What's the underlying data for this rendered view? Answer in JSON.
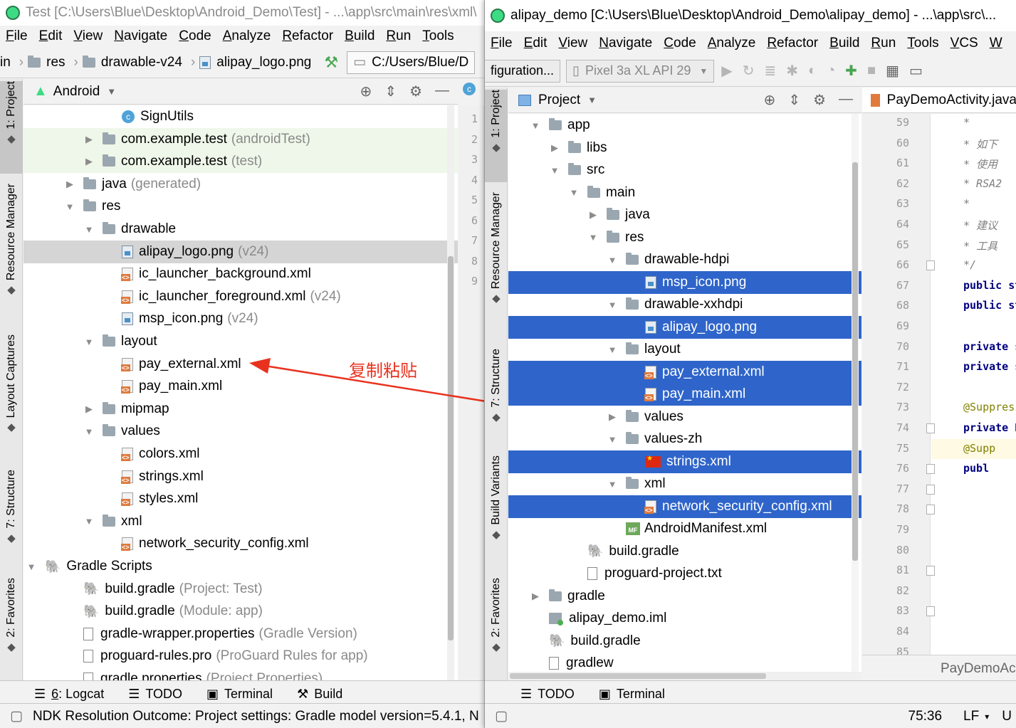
{
  "left_window": {
    "title": "Test [C:\\Users\\Blue\\Desktop\\Android_Demo\\Test] - ...\\app\\src\\main\\res\\xml\\",
    "menu": [
      "File",
      "Edit",
      "View",
      "Navigate",
      "Code",
      "Analyze",
      "Refactor",
      "Build",
      "Run",
      "Tools"
    ],
    "breadcrumb": [
      "in",
      "res",
      "drawable-v24",
      "alipay_logo.png"
    ],
    "path_field": "C:/Users/Blue/D",
    "panel_title": "Android",
    "side_tabs": [
      "1: Project",
      "Resource Manager",
      "Layout Captures",
      "7: Structure",
      "2: Favorites"
    ],
    "tree": [
      {
        "label": "SignUtils",
        "hint": "",
        "indent": 4,
        "icon": "java",
        "arrow": "none",
        "state": ""
      },
      {
        "label": "com.example.test",
        "hint": "(androidTest)",
        "indent": 3,
        "icon": "folder",
        "arrow": "right",
        "state": "green"
      },
      {
        "label": "com.example.test",
        "hint": "(test)",
        "indent": 3,
        "icon": "folder",
        "arrow": "right",
        "state": "green"
      },
      {
        "label": "java",
        "hint": "(generated)",
        "indent": 2,
        "icon": "folder",
        "arrow": "right",
        "state": ""
      },
      {
        "label": "res",
        "hint": "",
        "indent": 2,
        "icon": "folder",
        "arrow": "down",
        "state": ""
      },
      {
        "label": "drawable",
        "hint": "",
        "indent": 3,
        "icon": "folder",
        "arrow": "down",
        "state": ""
      },
      {
        "label": "alipay_logo.png",
        "hint": "(v24)",
        "indent": 4,
        "icon": "img",
        "arrow": "none",
        "state": "gray"
      },
      {
        "label": "ic_launcher_background.xml",
        "hint": "",
        "indent": 4,
        "icon": "xml",
        "arrow": "none",
        "state": ""
      },
      {
        "label": "ic_launcher_foreground.xml",
        "hint": "(v24)",
        "indent": 4,
        "icon": "xml",
        "arrow": "none",
        "state": ""
      },
      {
        "label": "msp_icon.png",
        "hint": "(v24)",
        "indent": 4,
        "icon": "img",
        "arrow": "none",
        "state": ""
      },
      {
        "label": "layout",
        "hint": "",
        "indent": 3,
        "icon": "folder",
        "arrow": "down",
        "state": ""
      },
      {
        "label": "pay_external.xml",
        "hint": "",
        "indent": 4,
        "icon": "xml",
        "arrow": "none",
        "state": ""
      },
      {
        "label": "pay_main.xml",
        "hint": "",
        "indent": 4,
        "icon": "xml",
        "arrow": "none",
        "state": ""
      },
      {
        "label": "mipmap",
        "hint": "",
        "indent": 3,
        "icon": "folder",
        "arrow": "right",
        "state": ""
      },
      {
        "label": "values",
        "hint": "",
        "indent": 3,
        "icon": "folder",
        "arrow": "down",
        "state": ""
      },
      {
        "label": "colors.xml",
        "hint": "",
        "indent": 4,
        "icon": "xml",
        "arrow": "none",
        "state": ""
      },
      {
        "label": "strings.xml",
        "hint": "",
        "indent": 4,
        "icon": "xml",
        "arrow": "none",
        "state": ""
      },
      {
        "label": "styles.xml",
        "hint": "",
        "indent": 4,
        "icon": "xml",
        "arrow": "none",
        "state": ""
      },
      {
        "label": "xml",
        "hint": "",
        "indent": 3,
        "icon": "folder",
        "arrow": "down",
        "state": ""
      },
      {
        "label": "network_security_config.xml",
        "hint": "",
        "indent": 4,
        "icon": "xml",
        "arrow": "none",
        "state": ""
      },
      {
        "label": "Gradle Scripts",
        "hint": "",
        "indent": 0,
        "icon": "gradle",
        "arrow": "down",
        "state": ""
      },
      {
        "label": "build.gradle",
        "hint": "(Project: Test)",
        "indent": 2,
        "icon": "gradle",
        "arrow": "none",
        "state": ""
      },
      {
        "label": "build.gradle",
        "hint": "(Module: app)",
        "indent": 2,
        "icon": "gradle",
        "arrow": "none",
        "state": ""
      },
      {
        "label": "gradle-wrapper.properties",
        "hint": "(Gradle Version)",
        "indent": 2,
        "icon": "txt",
        "arrow": "none",
        "state": ""
      },
      {
        "label": "proguard-rules.pro",
        "hint": "(ProGuard Rules for app)",
        "indent": 2,
        "icon": "txt",
        "arrow": "none",
        "state": ""
      },
      {
        "label": "gradle.properties",
        "hint": "(Project Properties)",
        "indent": 2,
        "icon": "txt",
        "arrow": "none",
        "state": ""
      }
    ],
    "editor_lines": [
      "1",
      "2",
      "3",
      "4",
      "5",
      "6",
      "7",
      "8",
      "9"
    ],
    "bottom_tabs": [
      {
        "num": "6",
        "label": ": Logcat"
      },
      {
        "num": "",
        "label": "TODO"
      },
      {
        "num": "",
        "label": "Terminal"
      },
      {
        "num": "",
        "label": "Build"
      }
    ],
    "status": "NDK Resolution Outcome: Project settings: Gradle model version=5.4.1, N"
  },
  "right_window": {
    "title": "alipay_demo [C:\\Users\\Blue\\Desktop\\Android_Demo\\alipay_demo] - ...\\app\\src\\...",
    "menu": [
      "File",
      "Edit",
      "View",
      "Navigate",
      "Code",
      "Analyze",
      "Refactor",
      "Build",
      "Run",
      "Tools",
      "VCS",
      "W"
    ],
    "run_config": "figuration...",
    "device": "Pixel 3a XL API 29",
    "panel_title": "Project",
    "side_tabs": [
      "1: Project",
      "Resource Manager",
      "7: Structure",
      "Build Variants",
      "2: Favorites"
    ],
    "tree": [
      {
        "label": "app",
        "indent": 1,
        "icon": "folder",
        "arrow": "down",
        "state": ""
      },
      {
        "label": "libs",
        "indent": 2,
        "icon": "folder",
        "arrow": "right",
        "state": ""
      },
      {
        "label": "src",
        "indent": 2,
        "icon": "folder",
        "arrow": "down",
        "state": ""
      },
      {
        "label": "main",
        "indent": 3,
        "icon": "folder",
        "arrow": "down",
        "state": ""
      },
      {
        "label": "java",
        "indent": 4,
        "icon": "folder",
        "arrow": "right",
        "state": ""
      },
      {
        "label": "res",
        "indent": 4,
        "icon": "folder",
        "arrow": "down",
        "state": ""
      },
      {
        "label": "drawable-hdpi",
        "indent": 5,
        "icon": "folder",
        "arrow": "down",
        "state": ""
      },
      {
        "label": "msp_icon.png",
        "indent": 6,
        "icon": "img",
        "arrow": "none",
        "state": "sel"
      },
      {
        "label": "drawable-xxhdpi",
        "indent": 5,
        "icon": "folder",
        "arrow": "down",
        "state": ""
      },
      {
        "label": "alipay_logo.png",
        "indent": 6,
        "icon": "img",
        "arrow": "none",
        "state": "sel"
      },
      {
        "label": "layout",
        "indent": 5,
        "icon": "folder",
        "arrow": "down",
        "state": ""
      },
      {
        "label": "pay_external.xml",
        "indent": 6,
        "icon": "xml",
        "arrow": "none",
        "state": "sel"
      },
      {
        "label": "pay_main.xml",
        "indent": 6,
        "icon": "xml",
        "arrow": "none",
        "state": "sel"
      },
      {
        "label": "values",
        "indent": 5,
        "icon": "folder",
        "arrow": "right",
        "state": ""
      },
      {
        "label": "values-zh",
        "indent": 5,
        "icon": "folder",
        "arrow": "down",
        "state": ""
      },
      {
        "label": "strings.xml",
        "indent": 6,
        "icon": "flag",
        "arrow": "none",
        "state": "sel"
      },
      {
        "label": "xml",
        "indent": 5,
        "icon": "folder",
        "arrow": "down",
        "state": ""
      },
      {
        "label": "network_security_config.xml",
        "indent": 6,
        "icon": "xml",
        "arrow": "none",
        "state": "sel"
      },
      {
        "label": "AndroidManifest.xml",
        "indent": 5,
        "icon": "mf",
        "arrow": "none",
        "state": ""
      },
      {
        "label": "build.gradle",
        "indent": 3,
        "icon": "gradle",
        "arrow": "none",
        "state": ""
      },
      {
        "label": "proguard-project.txt",
        "indent": 3,
        "icon": "txt",
        "arrow": "none",
        "state": ""
      },
      {
        "label": "gradle",
        "indent": 1,
        "icon": "folder",
        "arrow": "right",
        "state": ""
      },
      {
        "label": "alipay_demo.iml",
        "indent": 1,
        "icon": "iml",
        "arrow": "none",
        "state": ""
      },
      {
        "label": "build.gradle",
        "indent": 1,
        "icon": "gradle",
        "arrow": "none",
        "state": ""
      },
      {
        "label": "gradlew",
        "indent": 1,
        "icon": "txt",
        "arrow": "none",
        "state": ""
      }
    ],
    "editor_tab": "PayDemoActivity.java",
    "editor_footer": "PayDemoAc",
    "code": [
      {
        "ln": "59",
        "text": "*",
        "cls": "code-comment"
      },
      {
        "ln": "60",
        "text": "*  如下",
        "cls": "code-comment"
      },
      {
        "ln": "61",
        "text": "*  使用",
        "cls": "code-comment"
      },
      {
        "ln": "62",
        "text": "*  RSA2",
        "cls": "code-comment"
      },
      {
        "ln": "63",
        "text": "*",
        "cls": "code-comment"
      },
      {
        "ln": "64",
        "text": "*  建议",
        "cls": "code-comment"
      },
      {
        "ln": "65",
        "text": "*  工具",
        "cls": "code-comment"
      },
      {
        "ln": "66",
        "text": "*/",
        "cls": "code-comment"
      },
      {
        "ln": "67",
        "text": "public st",
        "cls": "code-kw"
      },
      {
        "ln": "68",
        "text": "public st",
        "cls": "code-kw"
      },
      {
        "ln": "69",
        "text": "",
        "cls": ""
      },
      {
        "ln": "70",
        "text": "private s",
        "cls": "code-kw"
      },
      {
        "ln": "71",
        "text": "private s",
        "cls": "code-kw"
      },
      {
        "ln": "72",
        "text": "",
        "cls": ""
      },
      {
        "ln": "73",
        "text": "@Suppress",
        "cls": "code-ann"
      },
      {
        "ln": "74",
        "text": "private H",
        "cls": "code-kw"
      },
      {
        "ln": "75",
        "text": "   @Supp",
        "cls": "code-ann"
      },
      {
        "ln": "76",
        "text": "   publ",
        "cls": "code-kw"
      },
      {
        "ln": "77",
        "text": "",
        "cls": ""
      },
      {
        "ln": "78",
        "text": "",
        "cls": ""
      },
      {
        "ln": "79",
        "text": "",
        "cls": ""
      },
      {
        "ln": "80",
        "text": "",
        "cls": ""
      },
      {
        "ln": "81",
        "text": "",
        "cls": ""
      },
      {
        "ln": "82",
        "text": "",
        "cls": ""
      },
      {
        "ln": "83",
        "text": "",
        "cls": ""
      },
      {
        "ln": "84",
        "text": "",
        "cls": ""
      },
      {
        "ln": "85",
        "text": "",
        "cls": ""
      }
    ],
    "bottom_tabs": [
      "TODO",
      "Terminal"
    ],
    "status_position": "75:36",
    "status_lf": "LF",
    "status_enc": "U"
  },
  "annotation": "复制粘贴",
  "colors": {
    "selection": "#2f65ca",
    "annotation": "#e8321f",
    "green_row": "#eef7e9"
  }
}
